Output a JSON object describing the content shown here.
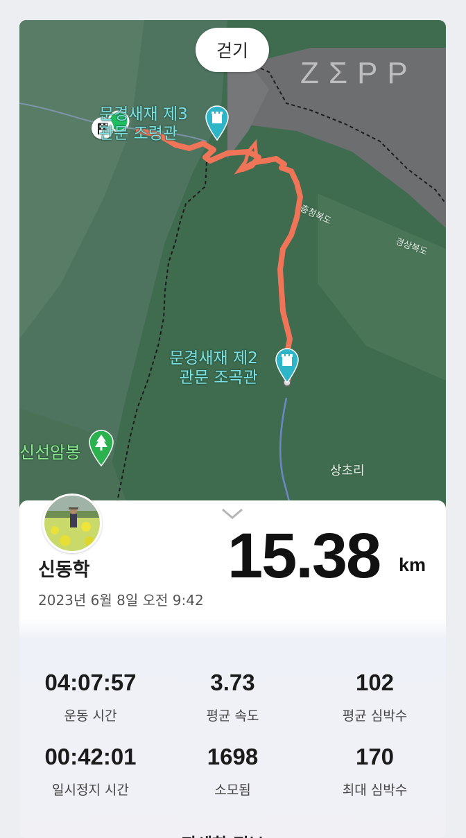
{
  "map": {
    "mode_label": "걷기",
    "brand": "ZΣPP",
    "poi_top": "문경새재 제3\n관문 조령관",
    "poi_bottom": "문경새재 제2\n관문 조곡관",
    "region_a": "충청북도",
    "region_b": "경상북도",
    "peak": "신선암봉",
    "village": "상초리",
    "colors": {
      "route": "#f07457",
      "poi": "#2fb5c8",
      "start_dot": "#1fbf5f",
      "peak_pin": "#2bb24f"
    }
  },
  "sheet": {
    "user_name": "신동학",
    "date": "2023년 6월 8일 오전 9:42",
    "distance": "15.38",
    "distance_unit": "km",
    "stats": [
      {
        "value": "04:07:57",
        "label": "운동 시간"
      },
      {
        "value": "3.73",
        "label": "평균 속도"
      },
      {
        "value": "102",
        "label": "평균 심박수"
      },
      {
        "value": "00:42:01",
        "label": "일시정지 시간"
      },
      {
        "value": "1698",
        "label": "소모됨"
      },
      {
        "value": "170",
        "label": "최대 심박수"
      }
    ],
    "more_label": "자세한 정보 >"
  }
}
